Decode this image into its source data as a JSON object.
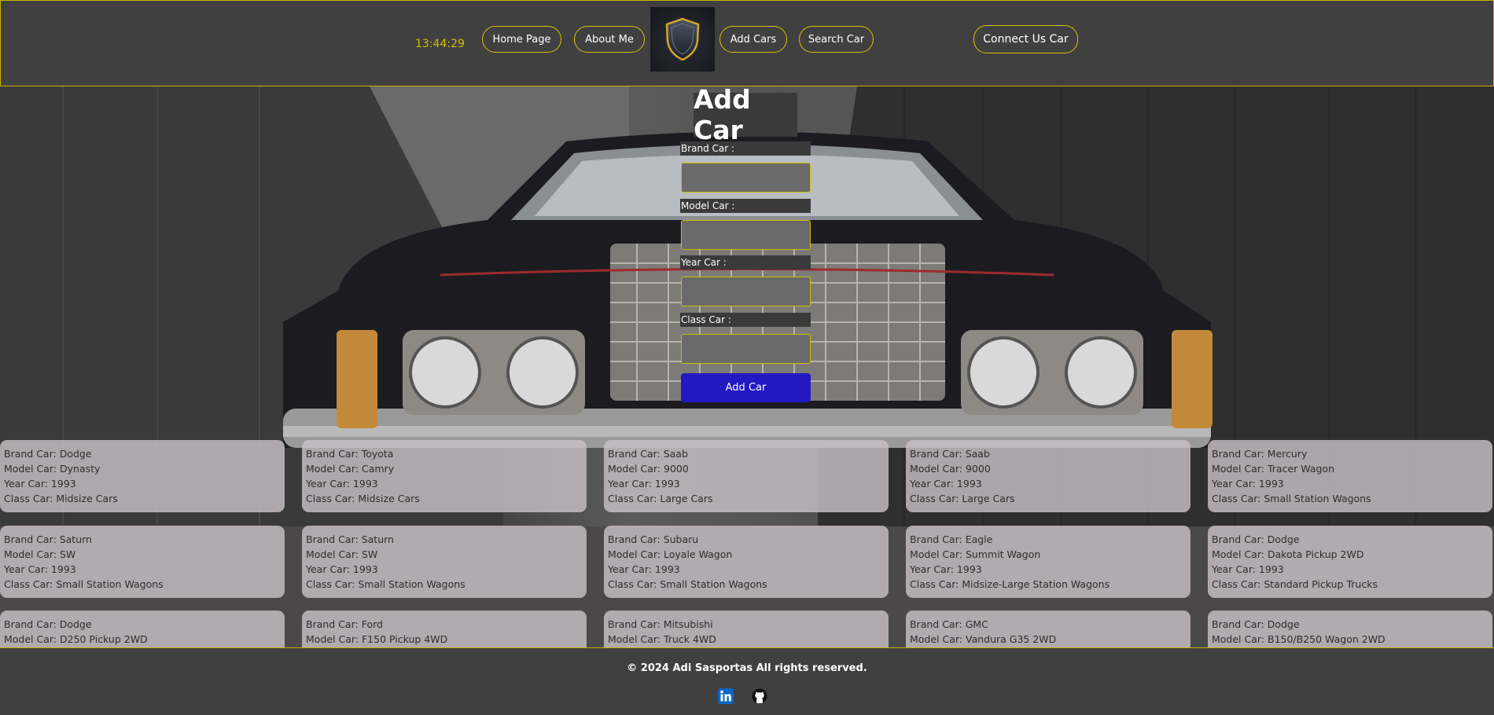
{
  "header": {
    "clock": "13:44:29",
    "nav": [
      "Home Page",
      "About Me",
      "Add Cars",
      "Search Car"
    ],
    "connect_button": "Connect Us Car",
    "accent_color": "#d9c300"
  },
  "form": {
    "title": "Add Car",
    "fields": [
      {
        "label": "Brand Car :",
        "value": ""
      },
      {
        "label": "Model Car :",
        "value": ""
      },
      {
        "label": "Year Car :",
        "value": ""
      },
      {
        "label": "Class Car :",
        "value": ""
      }
    ],
    "submit_label": "Add Car",
    "submit_color": "#2418c2"
  },
  "cars": [
    {
      "brand": "Brand Car: Dodge",
      "model": "Model Car: Dynasty",
      "year": "Year Car: 1993",
      "class": "Class Car: Midsize Cars"
    },
    {
      "brand": "Brand Car: Toyota",
      "model": "Model Car: Camry",
      "year": "Year Car: 1993",
      "class": "Class Car: Midsize Cars"
    },
    {
      "brand": "Brand Car: Saab",
      "model": "Model Car: 9000",
      "year": "Year Car: 1993",
      "class": "Class Car: Large Cars"
    },
    {
      "brand": "Brand Car: Saab",
      "model": "Model Car: 9000",
      "year": "Year Car: 1993",
      "class": "Class Car: Large Cars"
    },
    {
      "brand": "Brand Car: Mercury",
      "model": "Model Car: Tracer Wagon",
      "year": "Year Car: 1993",
      "class": "Class Car: Small Station Wagons"
    },
    {
      "brand": "Brand Car: Saturn",
      "model": "Model Car: SW",
      "year": "Year Car: 1993",
      "class": "Class Car: Small Station Wagons"
    },
    {
      "brand": "Brand Car: Saturn",
      "model": "Model Car: SW",
      "year": "Year Car: 1993",
      "class": "Class Car: Small Station Wagons"
    },
    {
      "brand": "Brand Car: Subaru",
      "model": "Model Car: Loyale Wagon",
      "year": "Year Car: 1993",
      "class": "Class Car: Small Station Wagons"
    },
    {
      "brand": "Brand Car: Eagle",
      "model": "Model Car: Summit Wagon",
      "year": "Year Car: 1993",
      "class": "Class Car: Midsize-Large Station Wagons"
    },
    {
      "brand": "Brand Car: Dodge",
      "model": "Model Car: Dakota Pickup 2WD",
      "year": "Year Car: 1993",
      "class": "Class Car: Standard Pickup Trucks"
    },
    {
      "brand": "Brand Car: Dodge",
      "model": "Model Car: D250 Pickup 2WD",
      "year": "",
      "class": ""
    },
    {
      "brand": "Brand Car: Ford",
      "model": "Model Car: F150 Pickup 4WD",
      "year": "",
      "class": ""
    },
    {
      "brand": "Brand Car: Mitsubishi",
      "model": "Model Car: Truck 4WD",
      "year": "",
      "class": ""
    },
    {
      "brand": "Brand Car: GMC",
      "model": "Model Car: Vandura G35 2WD",
      "year": "",
      "class": ""
    },
    {
      "brand": "Brand Car: Dodge",
      "model": "Model Car: B150/B250 Wagon 2WD",
      "year": "",
      "class": ""
    }
  ],
  "footer": {
    "copyright": "© 2024 Adi Sasportas All rights reserved.",
    "icons": [
      "linkedin-icon",
      "github-icon"
    ]
  }
}
